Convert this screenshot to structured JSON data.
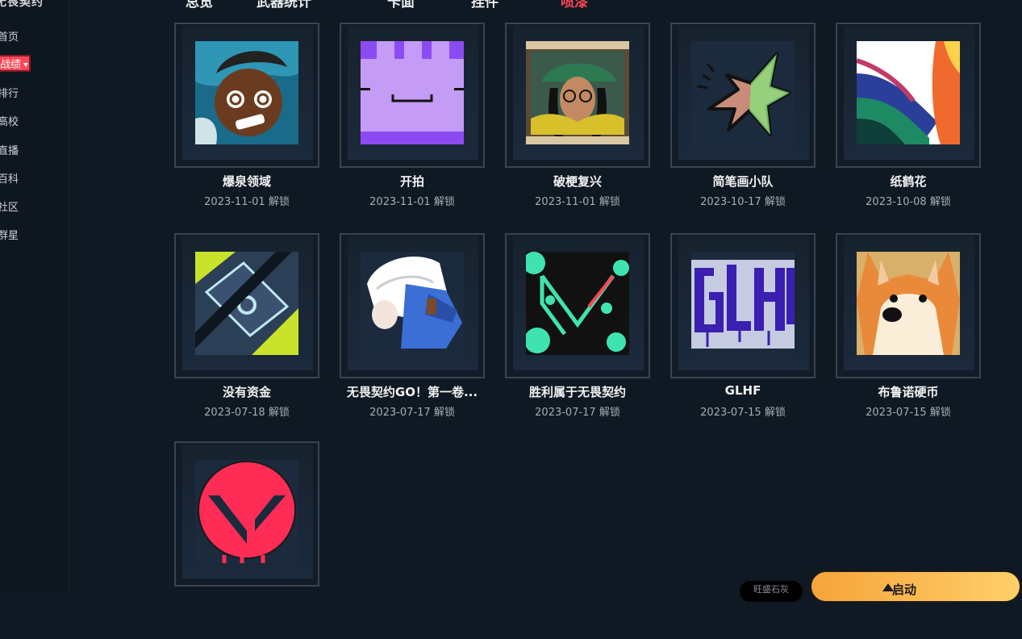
{
  "sidebar": {
    "brand": "无畏契约",
    "items": [
      {
        "label": "首页",
        "active": false
      },
      {
        "label": "战绩",
        "active": true
      },
      {
        "label": "排行",
        "active": false
      },
      {
        "label": "高校",
        "active": false
      },
      {
        "label": "直播",
        "active": false
      },
      {
        "label": "百科",
        "active": false
      },
      {
        "label": "社区",
        "active": false
      },
      {
        "label": "群星",
        "active": false
      }
    ]
  },
  "topbar": {
    "tabs": [
      "总览",
      "武器统计",
      "卡面",
      "挂件",
      "喷漆"
    ],
    "active_tab": "喷漆"
  },
  "sprays": [
    {
      "name": "爆泉领域",
      "date": "2023-11-01 解锁",
      "art": "comic-face"
    },
    {
      "name": "开拍",
      "date": "2023-11-01 解锁",
      "art": "purple-block"
    },
    {
      "name": "破梗复兴",
      "date": "2023-11-01 解锁",
      "art": "glasses-agent"
    },
    {
      "name": "简笔画小队",
      "date": "2023-10-17 解锁",
      "art": "star-bird"
    },
    {
      "name": "纸鹤花",
      "date": "2023-10-08 解锁",
      "art": "bird-of-paradise"
    },
    {
      "name": "没有资金",
      "date": "2023-07-18 解锁",
      "art": "no-money"
    },
    {
      "name": "无畏契约GO！第一卷...",
      "date": "2023-07-17 解锁",
      "art": "white-hair-agent"
    },
    {
      "name": "胜利属于无畏契约",
      "date": "2023-07-17 解锁",
      "art": "valorant-splat"
    },
    {
      "name": "GLHF",
      "date": "2023-07-15 解锁",
      "art": "glhf-graffiti"
    },
    {
      "name": "布鲁诺硬币",
      "date": "2023-07-15 解锁",
      "art": "corgi"
    },
    {
      "name": "",
      "date": "",
      "art": "valorant-logo-red"
    }
  ],
  "bottom": {
    "pill_label": "旺盛石灰",
    "action_label": "启动"
  },
  "colors": {
    "background": "#0f1923",
    "accent": "#ff4655",
    "frame_border": "#3a4350",
    "date_text": "#a7adb5"
  }
}
